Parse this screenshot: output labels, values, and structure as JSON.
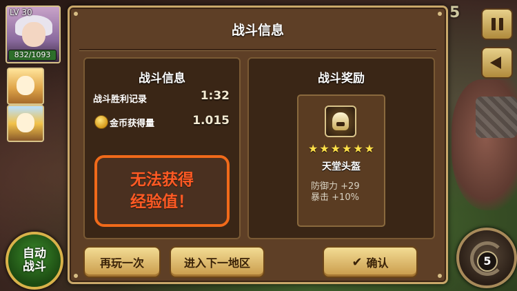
{
  "hud": {
    "level": "LV 30",
    "hp_text": "832/1093",
    "auto_battle_line1": "自动",
    "auto_battle_line2": "战斗",
    "skill_count": "5",
    "top_counter": "5"
  },
  "panel": {
    "title": "战斗信息",
    "left": {
      "title": "战斗信息",
      "rows": [
        {
          "label": "战斗胜利记录",
          "value": "1:32"
        },
        {
          "label": "金币获得量",
          "value": "1.015"
        }
      ],
      "warning_line1": "无法获得",
      "warning_line2": "经验值！"
    },
    "right": {
      "title": "战斗奖励",
      "item": {
        "name": "天堂头盔",
        "stars": 6,
        "stats": [
          {
            "label": "防御力",
            "value": "+29"
          },
          {
            "label": "暴击",
            "value": "+10%"
          }
        ]
      }
    },
    "buttons": {
      "replay": "再玩一次",
      "next_area": "进入下一地区",
      "confirm": "确认"
    }
  },
  "icons": {
    "coin": "coin-icon",
    "check": "check-icon",
    "pause": "pause-icon",
    "horn": "horn-icon",
    "helmet": "helmet-icon",
    "star": "star-icon"
  },
  "colors": {
    "warning_text": "#ff5a24",
    "warning_border": "#f06a1a",
    "button_gold": "#f3dc94",
    "panel_brown": "#5e3f26",
    "star_yellow": "#ffe14a"
  }
}
